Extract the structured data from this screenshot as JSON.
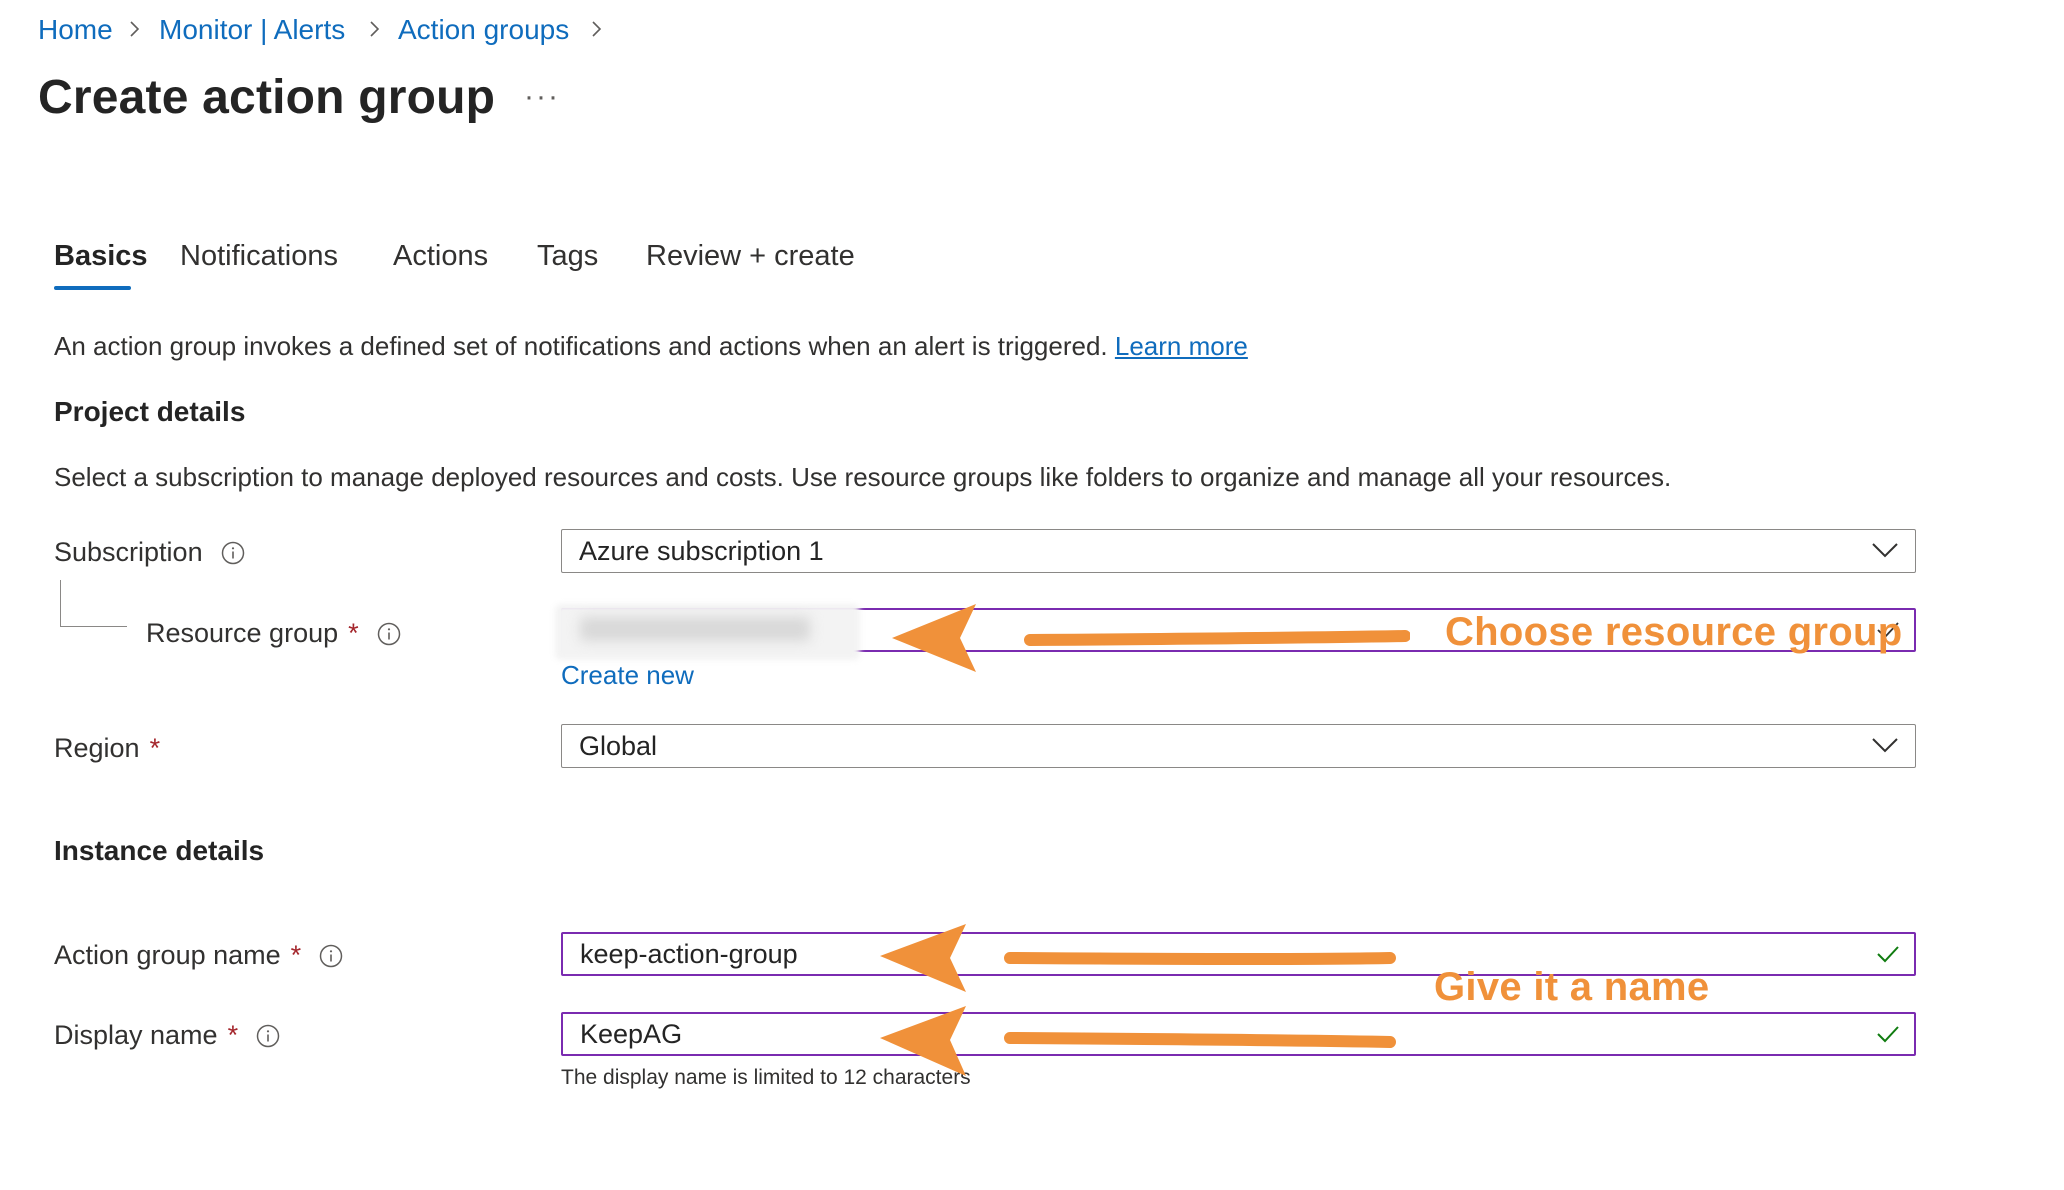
{
  "breadcrumb": {
    "items": [
      "Home",
      "Monitor | Alerts",
      "Action groups"
    ]
  },
  "page": {
    "title": "Create action group",
    "more_label": "···"
  },
  "tabs": [
    {
      "label": "Basics",
      "active": true
    },
    {
      "label": "Notifications",
      "active": false
    },
    {
      "label": "Actions",
      "active": false
    },
    {
      "label": "Tags",
      "active": false
    },
    {
      "label": "Review + create",
      "active": false
    }
  ],
  "intro": {
    "text": "An action group invokes a defined set of notifications and actions when an alert is triggered.",
    "link": "Learn more"
  },
  "project_details": {
    "heading": "Project details",
    "description": "Select a subscription to manage deployed resources and costs. Use resource groups like folders to organize and manage all your resources.",
    "subscription": {
      "label": "Subscription",
      "value": "Azure subscription 1"
    },
    "resource_group": {
      "label": "Resource group",
      "required_mark": "*",
      "create_new": "Create new"
    },
    "region": {
      "label": "Region",
      "required_mark": "*",
      "value": "Global"
    }
  },
  "instance_details": {
    "heading": "Instance details",
    "action_group_name": {
      "label": "Action group name",
      "required_mark": "*",
      "value": "keep-action-group"
    },
    "display_name": {
      "label": "Display name",
      "required_mark": "*",
      "value": "KeepAG",
      "hint": "The display name is limited to 12 characters"
    }
  },
  "annotations": {
    "choose_resource_group": "Choose resource group",
    "give_name": "Give it a name",
    "color": "#f0913a"
  },
  "colors": {
    "link": "#0f6cbd",
    "required": "#a4262c",
    "valid_border": "#7a2bb0",
    "check": "#107c10"
  }
}
